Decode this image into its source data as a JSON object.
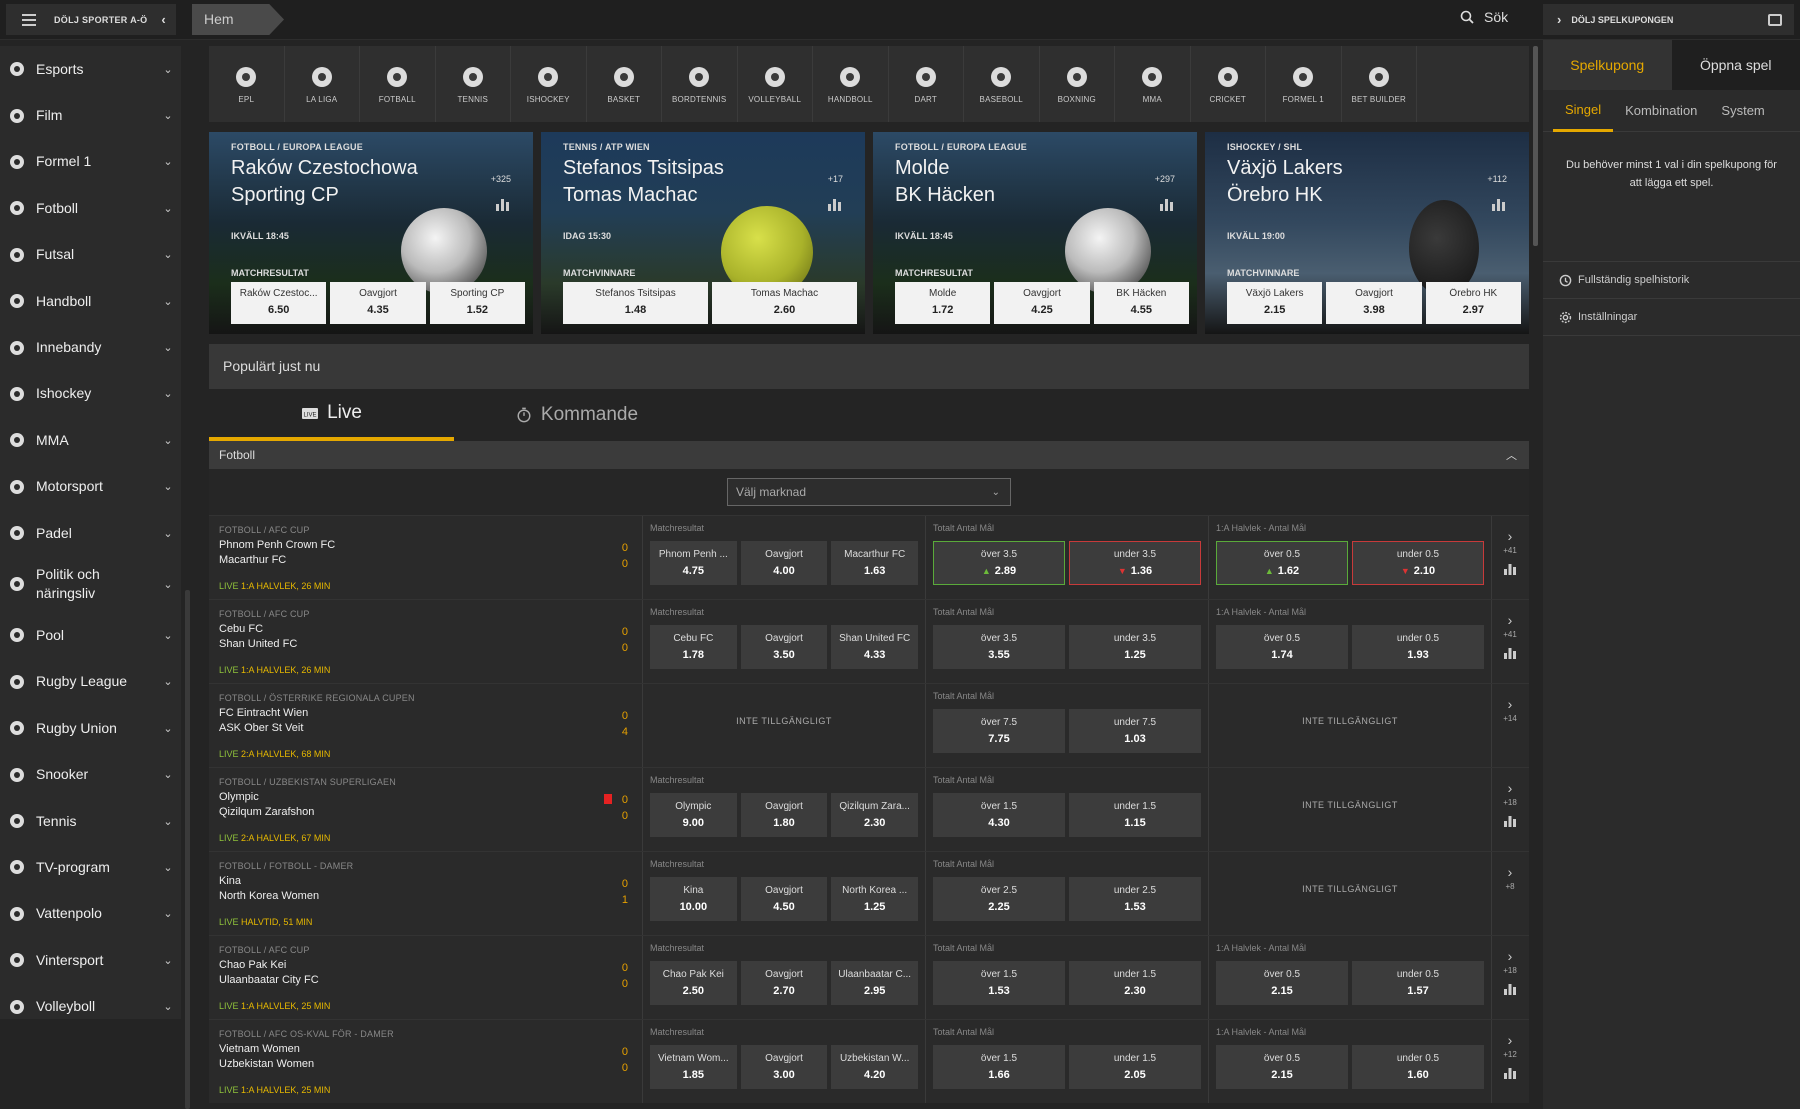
{
  "topbar": {
    "hide_sports": "DÖLJ SPORTER A-Ö",
    "breadcrumb": "Hem",
    "search": "Sök",
    "hide_coupon": "DÖLJ SPELKUPONGEN"
  },
  "sidebar": {
    "items": [
      {
        "label": "Esports",
        "icon": "esports-icon"
      },
      {
        "label": "Film",
        "icon": "film-icon"
      },
      {
        "label": "Formel 1",
        "icon": "flag-icon"
      },
      {
        "label": "Fotboll",
        "icon": "football-icon"
      },
      {
        "label": "Futsal",
        "icon": "futsal-icon"
      },
      {
        "label": "Handboll",
        "icon": "handball-icon"
      },
      {
        "label": "Innebandy",
        "icon": "floorball-icon"
      },
      {
        "label": "Ishockey",
        "icon": "hockey-icon"
      },
      {
        "label": "MMA",
        "icon": "mma-icon"
      },
      {
        "label": "Motorsport",
        "icon": "motorsport-icon"
      },
      {
        "label": "Padel",
        "icon": "padel-icon"
      },
      {
        "label": "Politik och näringsliv",
        "icon": "briefcase-icon"
      },
      {
        "label": "Pool",
        "icon": "pool-icon"
      },
      {
        "label": "Rugby League",
        "icon": "rugby-icon"
      },
      {
        "label": "Rugby Union",
        "icon": "rugby-union-icon"
      },
      {
        "label": "Snooker",
        "icon": "snooker-icon"
      },
      {
        "label": "Tennis",
        "icon": "tennis-icon"
      },
      {
        "label": "TV-program",
        "icon": "tv-icon"
      },
      {
        "label": "Vattenpolo",
        "icon": "waterpolo-icon"
      },
      {
        "label": "Vintersport",
        "icon": "mountain-icon"
      },
      {
        "label": "Volleyboll",
        "icon": "volleyball-icon"
      }
    ]
  },
  "categories": [
    "EPL",
    "LA LIGA",
    "FOTBALL",
    "TENNIS",
    "ISHOCKEY",
    "BASKET",
    "BORDTENNIS",
    "VOLLEYBALL",
    "HANDBOLL",
    "DART",
    "BASEBOLL",
    "BOXNING",
    "MMA",
    "CRICKET",
    "FORMEL 1",
    "BET BUILDER"
  ],
  "featured": [
    {
      "league": "FOTBOLL / EUROPA LEAGUE",
      "team1": "Raków Czestochowa",
      "team2": "Sporting CP",
      "more": "+325",
      "time": "IKVÄLL 18:45",
      "market": "MATCHRESULTAT",
      "odds": [
        {
          "name": "Raków Czestoc...",
          "value": "6.50"
        },
        {
          "name": "Oavgjort",
          "value": "4.35"
        },
        {
          "name": "Sporting CP",
          "value": "1.52"
        }
      ]
    },
    {
      "league": "TENNIS / ATP WIEN",
      "team1": "Stefanos Tsitsipas",
      "team2": "Tomas Machac",
      "more": "+17",
      "time": "IDAG 15:30",
      "market": "MATCHVINNARE",
      "odds": [
        {
          "name": "Stefanos Tsitsipas",
          "value": "1.48"
        },
        {
          "name": "Tomas Machac",
          "value": "2.60"
        }
      ]
    },
    {
      "league": "FOTBOLL / EUROPA LEAGUE",
      "team1": "Molde",
      "team2": "BK Häcken",
      "more": "+297",
      "time": "IKVÄLL 18:45",
      "market": "MATCHRESULTAT",
      "odds": [
        {
          "name": "Molde",
          "value": "1.72"
        },
        {
          "name": "Oavgjort",
          "value": "4.25"
        },
        {
          "name": "BK Häcken",
          "value": "4.55"
        }
      ]
    },
    {
      "league": "ISHOCKEY / SHL",
      "team1": "Växjö Lakers",
      "team2": "Örebro HK",
      "more": "+112",
      "time": "IKVÄLL 19:00",
      "market": "MATCHVINNARE",
      "odds": [
        {
          "name": "Växjö Lakers",
          "value": "2.15"
        },
        {
          "name": "Oavgjort",
          "value": "3.98"
        },
        {
          "name": "Örebro HK",
          "value": "2.97"
        }
      ]
    }
  ],
  "popular": "Populärt just nu",
  "tabs": {
    "live": "Live",
    "upcoming": "Kommande"
  },
  "section": "Fotboll",
  "market_select": "Välj marknad",
  "unavailable": "INTE TILLGÄNGLIGT",
  "events": [
    {
      "league": "FOTBOLL / AFC CUP",
      "team1": "Phnom Penh Crown FC",
      "team2": "Macarthur FC",
      "score1": "0",
      "score2": "0",
      "live": "LIVE",
      "status": "1:A HALVLEK, 26 MIN",
      "m1_label": "Matchresultat",
      "m1": [
        {
          "n": "Phnom Penh ...",
          "v": "4.75"
        },
        {
          "n": "Oavgjort",
          "v": "4.00"
        },
        {
          "n": "Macarthur FC",
          "v": "1.63"
        }
      ],
      "m2_label": "Totalt Antal Mål",
      "m2": [
        {
          "n": "över 3.5",
          "v": "2.89",
          "t": "up"
        },
        {
          "n": "under 3.5",
          "v": "1.36",
          "t": "down"
        }
      ],
      "m3_label": "1:A Halvlek - Antal Mål",
      "m3": [
        {
          "n": "över 0.5",
          "v": "1.62",
          "t": "up"
        },
        {
          "n": "under 0.5",
          "v": "2.10",
          "t": "down"
        }
      ],
      "more": "+41",
      "stats": true
    },
    {
      "league": "FOTBOLL / AFC CUP",
      "team1": "Cebu FC",
      "team2": "Shan United FC",
      "score1": "0",
      "score2": "0",
      "live": "LIVE",
      "status": "1:A HALVLEK, 26 MIN",
      "m1_label": "Matchresultat",
      "m1": [
        {
          "n": "Cebu FC",
          "v": "1.78"
        },
        {
          "n": "Oavgjort",
          "v": "3.50"
        },
        {
          "n": "Shan United FC",
          "v": "4.33"
        }
      ],
      "m2_label": "Totalt Antal Mål",
      "m2": [
        {
          "n": "över 3.5",
          "v": "3.55"
        },
        {
          "n": "under 3.5",
          "v": "1.25"
        }
      ],
      "m3_label": "1:A Halvlek - Antal Mål",
      "m3": [
        {
          "n": "över 0.5",
          "v": "1.74"
        },
        {
          "n": "under 0.5",
          "v": "1.93"
        }
      ],
      "more": "+41",
      "stats": true
    },
    {
      "league": "FOTBOLL / ÖSTERRIKE REGIONALA CUPEN",
      "team1": "FC Eintracht Wien",
      "team2": "ASK Ober St Veit",
      "score1": "0",
      "score2": "4",
      "live": "LIVE",
      "status": "2:A HALVLEK, 68 MIN",
      "m1_label": "",
      "m1": [],
      "m2_label": "Totalt Antal Mål",
      "m2": [
        {
          "n": "över 7.5",
          "v": "7.75"
        },
        {
          "n": "under 7.5",
          "v": "1.03"
        }
      ],
      "m3_label": "",
      "m3": [],
      "more": "+14",
      "stats": false
    },
    {
      "league": "FOTBOLL / UZBEKISTAN SUPERLIGAEN",
      "team1": "Olympic",
      "team2": "Qizilqum Zarafshon",
      "score1": "0",
      "score2": "0",
      "redcard": true,
      "live": "LIVE",
      "status": "2:A HALVLEK, 67 MIN",
      "m1_label": "Matchresultat",
      "m1": [
        {
          "n": "Olympic",
          "v": "9.00"
        },
        {
          "n": "Oavgjort",
          "v": "1.80"
        },
        {
          "n": "Qizilqum Zara...",
          "v": "2.30"
        }
      ],
      "m2_label": "Totalt Antal Mål",
      "m2": [
        {
          "n": "över 1.5",
          "v": "4.30"
        },
        {
          "n": "under 1.5",
          "v": "1.15"
        }
      ],
      "m3_label": "",
      "m3": [],
      "more": "+18",
      "stats": true
    },
    {
      "league": "FOTBOLL / FOTBOLL - DAMER",
      "team1": "Kina",
      "team2": "North Korea Women",
      "score1": "0",
      "score2": "1",
      "live": "LIVE",
      "status": "HALVTID, 51 MIN",
      "m1_label": "Matchresultat",
      "m1": [
        {
          "n": "Kina",
          "v": "10.00"
        },
        {
          "n": "Oavgjort",
          "v": "4.50"
        },
        {
          "n": "North Korea ...",
          "v": "1.25"
        }
      ],
      "m2_label": "Totalt Antal Mål",
      "m2": [
        {
          "n": "över 2.5",
          "v": "2.25"
        },
        {
          "n": "under 2.5",
          "v": "1.53"
        }
      ],
      "m3_label": "",
      "m3": [],
      "more": "+8",
      "stats": false
    },
    {
      "league": "FOTBOLL / AFC CUP",
      "team1": "Chao Pak Kei",
      "team2": "Ulaanbaatar City FC",
      "score1": "0",
      "score2": "0",
      "live": "LIVE",
      "status": "1:A HALVLEK, 25 MIN",
      "m1_label": "Matchresultat",
      "m1": [
        {
          "n": "Chao Pak Kei",
          "v": "2.50"
        },
        {
          "n": "Oavgjort",
          "v": "2.70"
        },
        {
          "n": "Ulaanbaatar C...",
          "v": "2.95"
        }
      ],
      "m2_label": "Totalt Antal Mål",
      "m2": [
        {
          "n": "över 1.5",
          "v": "1.53"
        },
        {
          "n": "under 1.5",
          "v": "2.30"
        }
      ],
      "m3_label": "1:A Halvlek - Antal Mål",
      "m3": [
        {
          "n": "över 0.5",
          "v": "2.15"
        },
        {
          "n": "under 0.5",
          "v": "1.57"
        }
      ],
      "more": "+18",
      "stats": true
    },
    {
      "league": "FOTBOLL / AFC OS-KVAL FÖR - DAMER",
      "team1": "Vietnam Women",
      "team2": "Uzbekistan Women",
      "score1": "0",
      "score2": "0",
      "live": "LIVE",
      "status": "1:A HALVLEK, 25 MIN",
      "m1_label": "Matchresultat",
      "m1": [
        {
          "n": "Vietnam Wom...",
          "v": "1.85"
        },
        {
          "n": "Oavgjort",
          "v": "3.00"
        },
        {
          "n": "Uzbekistan W...",
          "v": "4.20"
        }
      ],
      "m2_label": "Totalt Antal Mål",
      "m2": [
        {
          "n": "över 1.5",
          "v": "1.66"
        },
        {
          "n": "under 1.5",
          "v": "2.05"
        }
      ],
      "m3_label": "1:A Halvlek - Antal Mål",
      "m3": [
        {
          "n": "över 0.5",
          "v": "2.15"
        },
        {
          "n": "under 0.5",
          "v": "1.60"
        }
      ],
      "more": "+12",
      "stats": true
    }
  ],
  "coupon": {
    "tabs": [
      "Spelkupong",
      "Öppna spel"
    ],
    "subtabs": [
      "Singel",
      "Kombination",
      "System"
    ],
    "message": "Du behöver minst 1 val i din spelkupong för att lägga ett spel.",
    "history": "Fullständig spelhistorik",
    "settings": "Inställningar"
  },
  "colors": {
    "accent": "#e5a800",
    "live_green": "#8fc23b",
    "up": "#5aaa3a",
    "down": "#c73a3a"
  }
}
